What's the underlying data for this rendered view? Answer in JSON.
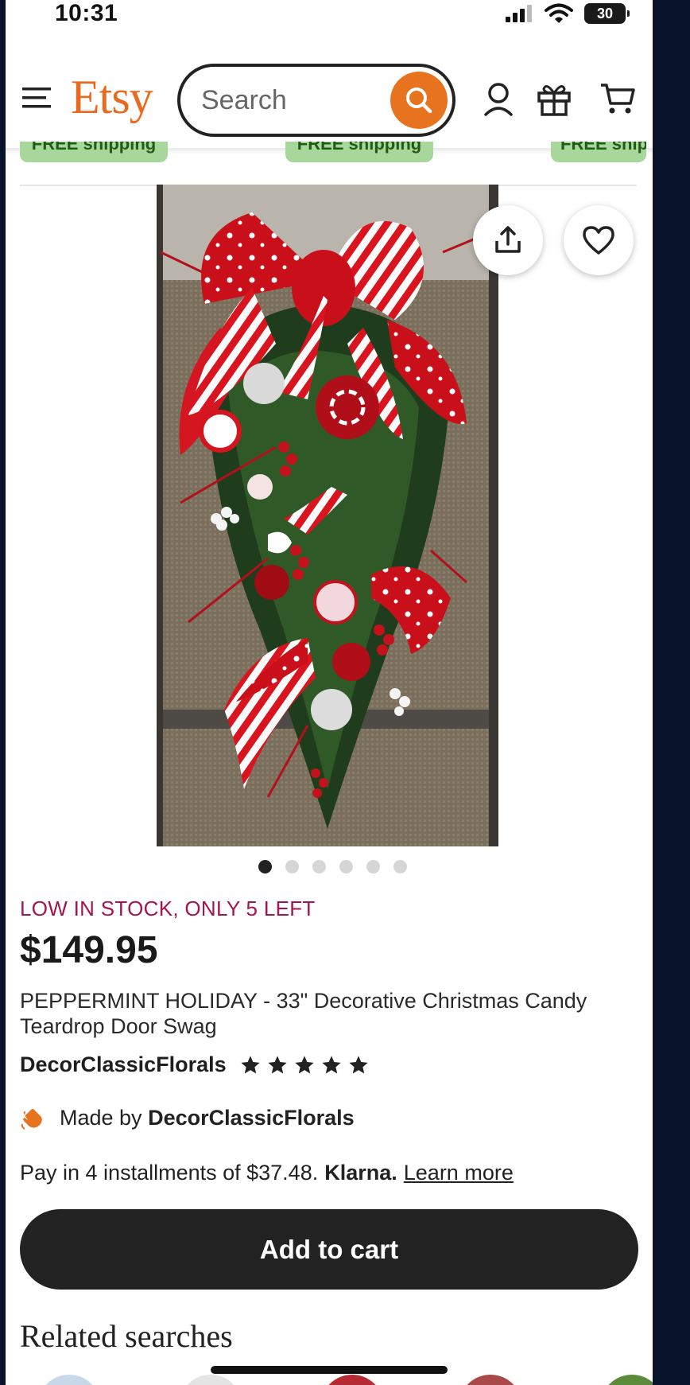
{
  "status_bar": {
    "time": "10:31",
    "battery": "30"
  },
  "header": {
    "logo": "Etsy",
    "search_placeholder": "Search",
    "brand_color": "#e8731f"
  },
  "chips": [
    "FREE shipping",
    "FREE shipping",
    "FREE shipping"
  ],
  "product": {
    "image_count": 6,
    "active_image_index": 0,
    "stock_notice": "LOW IN STOCK, ONLY 5 LEFT",
    "price": "$149.95",
    "title": "PEPPERMINT HOLIDAY - 33\" Decorative Christmas Candy Teardrop Door Swag",
    "shop_name": "DecorClassicFlorals",
    "rating_stars": 5,
    "made_by_prefix": "Made by",
    "made_by_shop": "DecorClassicFlorals",
    "klarna_text": "Pay in 4 installments of $37.48.",
    "klarna_brand": "Klarna.",
    "klarna_link": "Learn more",
    "add_to_cart": "Add to cart"
  },
  "related_heading": "Related searches",
  "icons": [
    "menu-icon",
    "search-icon",
    "account-icon",
    "gift-icon",
    "cart-icon",
    "share-icon",
    "heart-icon",
    "hand-wave-icon",
    "star-icon"
  ]
}
